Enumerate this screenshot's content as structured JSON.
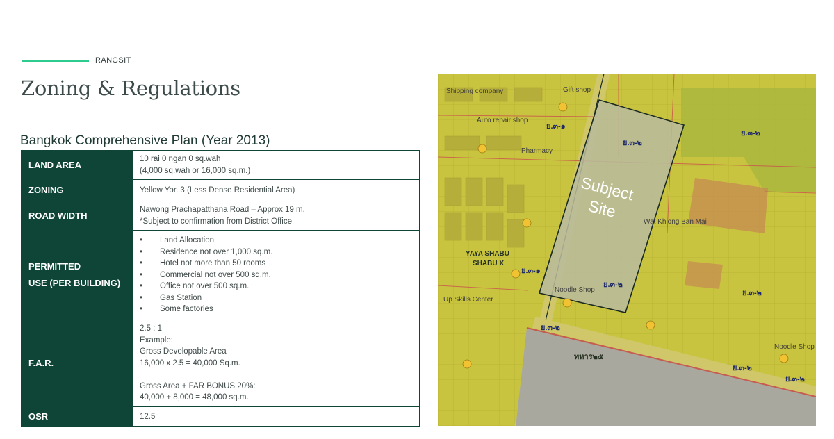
{
  "header": {
    "section_tag": "RANGSIT",
    "title": "Zoning & Regulations",
    "accent_color": "#2ecb8e"
  },
  "table": {
    "title": "Bangkok Comprehensive Plan (Year 2013)",
    "header_color": "#0e4536",
    "rows": [
      {
        "label": "LAND AREA",
        "lines": [
          "10 rai 0 ngan 0 sq.wah",
          "(4,000 sq.wah or 16,000 sq.m.)"
        ]
      },
      {
        "label": "ZONING",
        "lines": [
          "Yellow Yor. 3 (Less Dense Residential Area)"
        ]
      },
      {
        "label": "ROAD WIDTH",
        "lines": [
          "Nawong Prachapatthana Road – Approx 19 m.",
          "*Subject to confirmation from District Office"
        ]
      },
      {
        "label_lines": [
          "PERMITTED",
          "USE (PER BUILDING)"
        ],
        "bullets": [
          "Land Allocation",
          "Residence not over 1,000 sq.m.",
          "Hotel not more than 50 rooms",
          "Commercial not over 500 sq.m.",
          "Office not over 500 sq.m.",
          "Gas Station",
          "Some factories"
        ]
      },
      {
        "label": "F.A.R.",
        "lines": [
          "2.5 : 1",
          "Example:",
          "Gross Developable Area",
          "16,000 x 2.5 = 40,000 Sq.m.",
          "",
          "Gross Area  + FAR BONUS 20%:",
          "40,000 + 8,000 = 48,000 sq.m."
        ]
      },
      {
        "label": "OSR",
        "lines": [
          "12.5"
        ]
      }
    ]
  },
  "map": {
    "subject_label": [
      "Subject",
      "Site"
    ],
    "zone_labels": {
      "z1": "ย.๓-๑",
      "z2": "ย.๓-๒",
      "z3": "ย.๓-๒",
      "z4": "ย.๓-๑",
      "z5": "ย.๓-๒",
      "z6": "ย.๓-๒",
      "z7": "ย.๓-๒",
      "z8": "ทหาร๒๕",
      "z9": "ย.๓-๒",
      "z10": "ย.๓-๒"
    },
    "place_labels": {
      "gift_shop": "Gift shop",
      "auto_repair": "Auto repair shop",
      "noodle_shop": "Noodle Shop",
      "yaya": "YAYA SHABU",
      "yaya2": "SHABU X",
      "wat": "Wat Khlong Ban Mai",
      "upskills": "Up Skills Center",
      "noodle_shop2": "Noodle Shop",
      "shipping": "Shipping company",
      "pharmacy": "Pharmacy"
    },
    "colors": {
      "zone_yellow": "#c9c43f",
      "zone_red": "#c98a5a",
      "zone_gray": "#a9a89e",
      "site_fill": "#b9bb9e",
      "site_border": "#1b2a22"
    }
  }
}
